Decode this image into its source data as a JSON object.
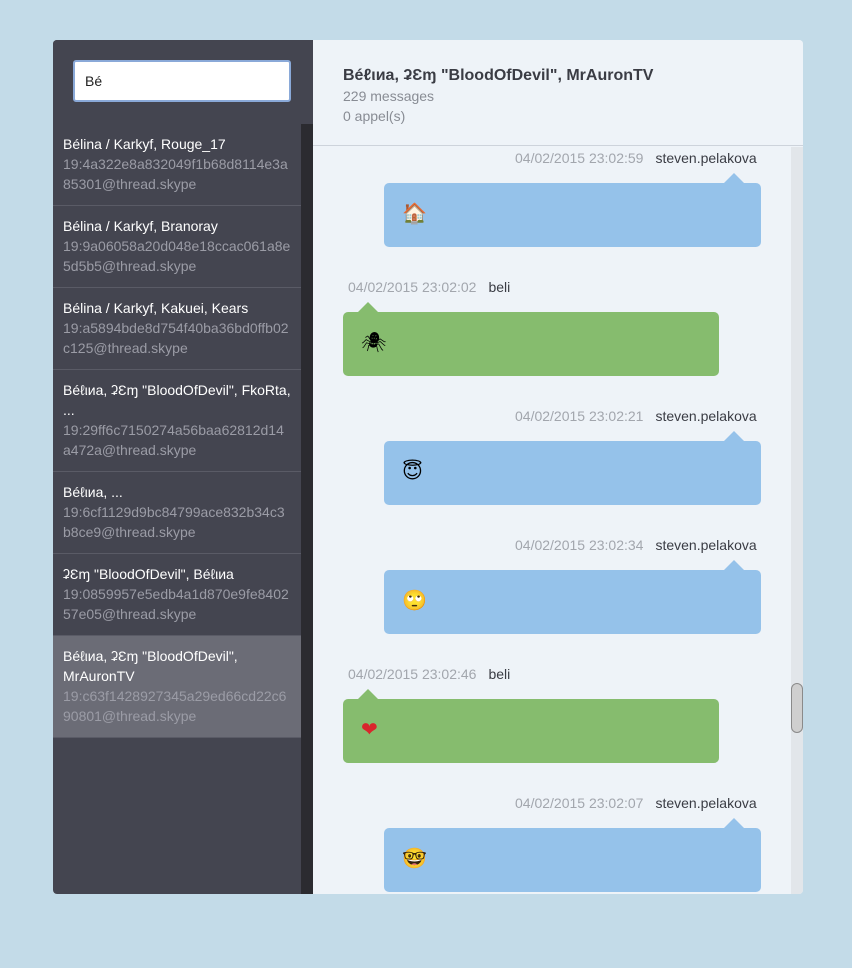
{
  "search": {
    "value": "Bé"
  },
  "sidebar": {
    "items": [
      {
        "title": "Bélina / Karkyf, Rouge_17",
        "sub": "19:4a322e8a832049f1b68d8114e3a85301@thread.skype"
      },
      {
        "title": "Bélina / Karkyf, Branoray",
        "sub": "19:9a06058a20d048e18ccac061a8e5d5b5@thread.skype"
      },
      {
        "title": "Bélina / Karkyf, Kakuei, Kears",
        "sub": "19:a5894bde8d754f40ba36bd0ffb02c125@thread.skype"
      },
      {
        "title": "Béℓιиa, ʡƐɱ \"BloodOfDevil\", FkoRta, ...",
        "sub": "19:29ff6c7150274a56baa62812d14a472a@thread.skype"
      },
      {
        "title": "Béℓιиa, ...",
        "sub": "19:6cf1129d9bc84799ace832b34c3b8ce9@thread.skype"
      },
      {
        "title": "ʡƐɱ \"BloodOfDevil\", Béℓιиa",
        "sub": "19:0859957e5edb4a1d870e9fe840257e05@thread.skype"
      },
      {
        "title": "Béℓιиa, ʡƐɱ \"BloodOfDevil\", MrAuronTV",
        "sub": "19:c63f1428927345a29ed66cd22c690801@thread.skype"
      }
    ]
  },
  "conversation": {
    "title": "Béℓιиa, ʡƐɱ \"BloodOfDevil\", MrAuronTV",
    "messages_count": "229 messages",
    "calls_count": "0 appel(s)"
  },
  "messages": [
    {
      "time": "04/02/2015 23:02:59",
      "user": "steven.pelakova",
      "emoji": "🏠",
      "emoji_name": "house-icon"
    },
    {
      "time": "04/02/2015 23:02:02",
      "user": "beli",
      "emoji": "🕷",
      "emoji_name": "spider-icon"
    },
    {
      "time": "04/02/2015 23:02:21",
      "user": "steven.pelakova",
      "emoji": "😇",
      "emoji_name": "angel-smiley-icon"
    },
    {
      "time": "04/02/2015 23:02:34",
      "user": "steven.pelakova",
      "emoji": "🙄",
      "emoji_name": "eyeroll-smiley-icon"
    },
    {
      "time": "04/02/2015 23:02:46",
      "user": "beli",
      "emoji": "❤",
      "emoji_name": "heart-icon"
    },
    {
      "time": "04/02/2015 23:02:07",
      "user": "steven.pelakova",
      "emoji": "🤓",
      "emoji_name": "nerd-smiley-icon"
    }
  ],
  "colors": {
    "sent": "#95c2ea",
    "received": "#86bc6e",
    "sidebar": "#444550",
    "selected": "#6b6c76",
    "page_bg": "#c3dbe8"
  }
}
